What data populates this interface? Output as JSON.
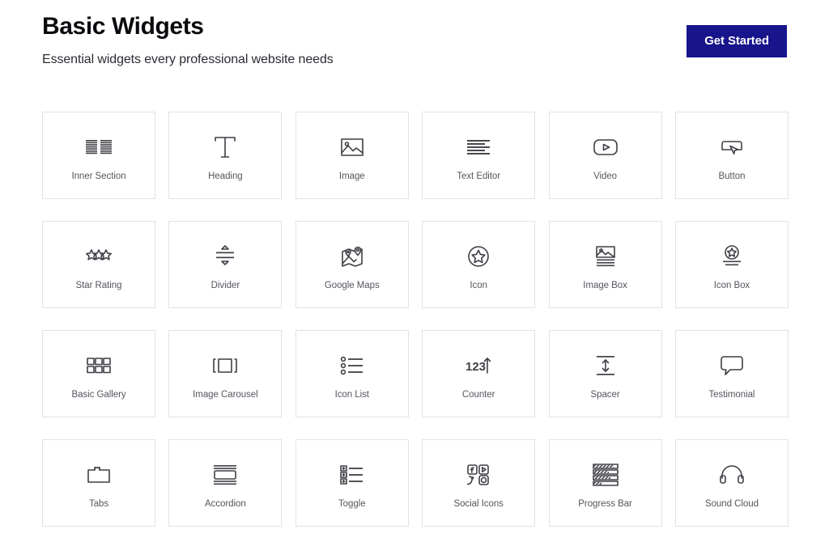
{
  "header": {
    "title": "Basic Widgets",
    "subtitle": "Essential widgets every professional website needs",
    "cta_label": "Get Started",
    "cta_color": "#17148c"
  },
  "colors": {
    "page_background": "#ffffff",
    "card_border": "#e2e2e4",
    "icon_stroke": "#3f3f46",
    "label_text": "#55555f",
    "title_text": "#0b0b0f"
  },
  "grid": {
    "columns": 6,
    "rows": 4,
    "widgets": [
      {
        "label": "Inner Section",
        "icon": "inner-section-icon"
      },
      {
        "label": "Heading",
        "icon": "heading-icon"
      },
      {
        "label": "Image",
        "icon": "image-icon"
      },
      {
        "label": "Text Editor",
        "icon": "text-editor-icon"
      },
      {
        "label": "Video",
        "icon": "video-icon"
      },
      {
        "label": "Button",
        "icon": "button-icon"
      },
      {
        "label": "Star Rating",
        "icon": "star-rating-icon"
      },
      {
        "label": "Divider",
        "icon": "divider-icon"
      },
      {
        "label": "Google Maps",
        "icon": "google-maps-icon"
      },
      {
        "label": "Icon",
        "icon": "icon-star-circle-icon"
      },
      {
        "label": "Image Box",
        "icon": "image-box-icon"
      },
      {
        "label": "Icon Box",
        "icon": "icon-box-icon"
      },
      {
        "label": "Basic Gallery",
        "icon": "basic-gallery-icon"
      },
      {
        "label": "Image Carousel",
        "icon": "image-carousel-icon"
      },
      {
        "label": "Icon List",
        "icon": "icon-list-icon"
      },
      {
        "label": "Counter",
        "icon": "counter-icon"
      },
      {
        "label": "Spacer",
        "icon": "spacer-icon"
      },
      {
        "label": "Testimonial",
        "icon": "testimonial-icon"
      },
      {
        "label": "Tabs",
        "icon": "tabs-icon"
      },
      {
        "label": "Accordion",
        "icon": "accordion-icon"
      },
      {
        "label": "Toggle",
        "icon": "toggle-icon"
      },
      {
        "label": "Social Icons",
        "icon": "social-icons-icon"
      },
      {
        "label": "Progress Bar",
        "icon": "progress-bar-icon"
      },
      {
        "label": "Sound Cloud",
        "icon": "sound-cloud-icon"
      }
    ]
  },
  "counter_icon_text": "123"
}
